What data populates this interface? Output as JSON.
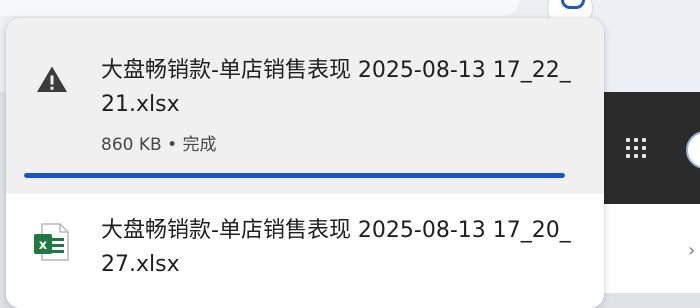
{
  "downloads": {
    "items": [
      {
        "filename": "大盘畅销款-单店销售表现 2025-08-13 17_22_21.xlsx",
        "size": "860 KB",
        "status": "完成",
        "progress": 1.0,
        "icon": "warning-icon"
      },
      {
        "filename": "大盘畅销款-单店销售表现 2025-08-13 17_20_27.xlsx",
        "icon": "excel-file-icon"
      }
    ]
  },
  "colors": {
    "accent": "#1a55c5",
    "excel_green": "#1d7a43"
  },
  "background": {
    "apps_icon": "apps-grid-icon",
    "side_nav_icon": "chevron-right-icon"
  }
}
